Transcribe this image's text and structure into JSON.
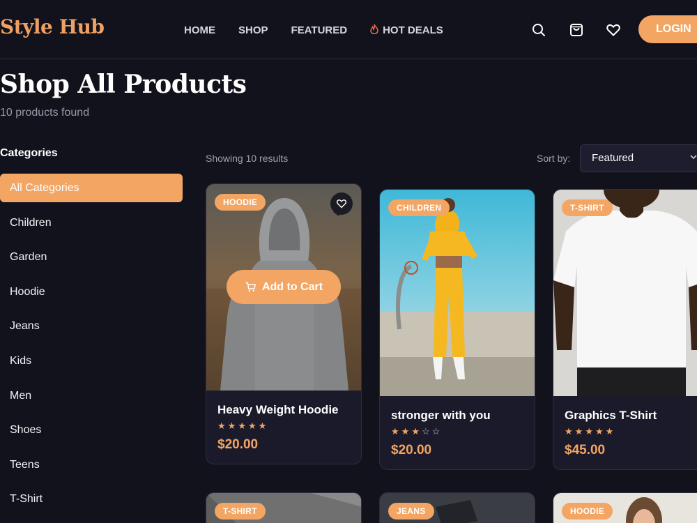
{
  "header": {
    "logo": "Style Hub",
    "nav": [
      "HOME",
      "SHOP",
      "FEATURED",
      "HOT DEALS"
    ],
    "icons": [
      "search-icon",
      "shopping-bag-icon",
      "heart-icon"
    ],
    "login_label": "LOGIN"
  },
  "page": {
    "title": "Shop All Products",
    "subtitle": "10 products found"
  },
  "sidebar": {
    "heading": "Categories",
    "categories": [
      "All Categories",
      "Children",
      "Garden",
      "Hoodie",
      "Jeans",
      "Kids",
      "Men",
      "Shoes",
      "Teens",
      "T-Shirt"
    ],
    "active_index": 0
  },
  "toolbar": {
    "results": "Showing 10 results",
    "sort_label": "Sort by:",
    "sort_value": "Featured"
  },
  "products": [
    {
      "badge": "HOODIE",
      "name": "Heavy Weight Hoodie",
      "rating": 5,
      "price": "$20.00",
      "hover_action": "Add to Cart"
    },
    {
      "badge": "CHILDREN",
      "name": "stronger with you",
      "rating": 3,
      "price": "$20.00"
    },
    {
      "badge": "T-SHIRT",
      "name": "Graphics T-Shirt",
      "rating": 5,
      "price": "$45.00"
    },
    {
      "badge": "T-SHIRT"
    },
    {
      "badge": "JEANS"
    },
    {
      "badge": "HOODIE"
    }
  ],
  "colors": {
    "accent": "#f3a563",
    "background": "#12121c",
    "card": "#1a1a2b"
  }
}
